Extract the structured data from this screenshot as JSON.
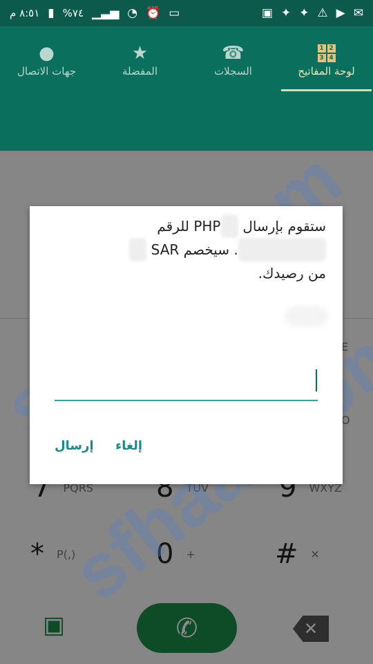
{
  "status_bar": {
    "time": "٨:٥١ م",
    "battery": "%٧٤",
    "icons": [
      "signal-icon",
      "wifi-icon",
      "alarm-icon",
      "cast-icon",
      "sim-icon",
      "wrench-icon",
      "wrench-icon",
      "warning-icon",
      "video-icon",
      "message-icon"
    ]
  },
  "tabs": [
    {
      "label": "لوحة المفاتيح",
      "icon": "keypad-icon",
      "active": true,
      "grid": [
        "1",
        "2",
        "3",
        "4"
      ]
    },
    {
      "label": "السجلات",
      "icon": "call-log-icon",
      "active": false
    },
    {
      "label": "المفضلة",
      "icon": "star-icon",
      "active": false
    },
    {
      "label": "جهات الاتصال",
      "icon": "person-icon",
      "active": false
    }
  ],
  "dialog": {
    "line1_prefix": "ستقوم بإرسال",
    "line1_code": "PHP",
    "line1_suffix": "للرقم",
    "line2_prefix": "سيخصم",
    "line2_currency": "SAR",
    "line3": "من رصيدك.",
    "cancel_label": "إلغاء",
    "send_label": "إرسال"
  },
  "keypad": {
    "row7": {
      "num": "7",
      "letters": "PQRS"
    },
    "row8": {
      "num": "8",
      "letters": "TUV"
    },
    "row9": {
      "num": "9",
      "letters": "WXYZ"
    },
    "star": {
      "num": "*",
      "sub": "P(,)"
    },
    "zero": {
      "num": "0",
      "sub": "+"
    },
    "hash": {
      "num": "#",
      "sub": "mute-icon"
    },
    "partial_o": "O",
    "partial_e": "E"
  },
  "watermark": "sfhaat.com"
}
